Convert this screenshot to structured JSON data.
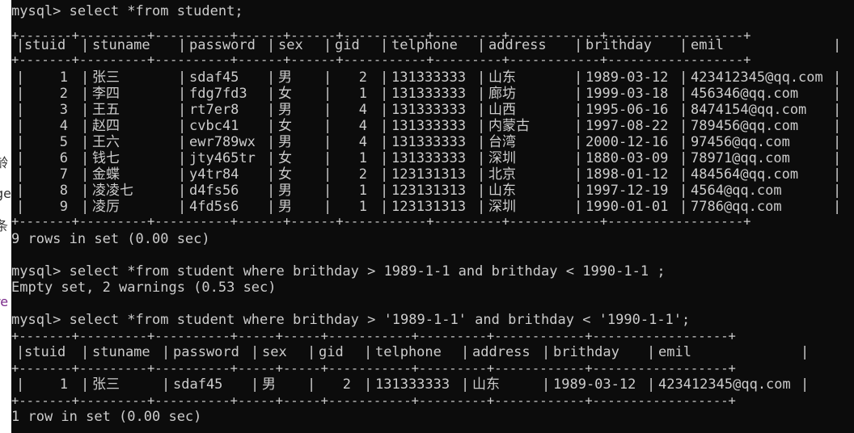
{
  "terminal": {
    "prompt": "mysql>",
    "lines": [
      {
        "kind": "cmd",
        "text": "select *from student;"
      },
      {
        "kind": "border",
        "text": "+-------+---------+----------+------+------+-----------+---------+------------+------------------+"
      },
      {
        "kind": "row",
        "cells": [
          "stuid",
          "stuname",
          "password",
          "sex",
          "gid",
          "telphone",
          "address",
          "brithday",
          "emil"
        ],
        "align": [
          "l",
          "l",
          "l",
          "l",
          "l",
          "l",
          "l",
          "l",
          "l"
        ]
      },
      {
        "kind": "border",
        "text": "+-------+---------+----------+------+------+-----------+---------+------------+------------------+"
      },
      {
        "kind": "row",
        "cells": [
          "1",
          "张三",
          "sdaf45",
          "男",
          "2",
          "131333333",
          "山东",
          "1989-03-12",
          "423412345@qq.com"
        ],
        "align": [
          "r",
          "l",
          "l",
          "l",
          "r",
          "l",
          "l",
          "l",
          "l"
        ]
      },
      {
        "kind": "row",
        "cells": [
          "2",
          "李四",
          "fdg7fd3",
          "女",
          "1",
          "131333333",
          "廊坊",
          "1999-03-18",
          "456346@qq.com"
        ],
        "align": [
          "r",
          "l",
          "l",
          "l",
          "r",
          "l",
          "l",
          "l",
          "l"
        ]
      },
      {
        "kind": "row",
        "cells": [
          "3",
          "王五",
          "rt7er8",
          "男",
          "4",
          "131333333",
          "山西",
          "1995-06-16",
          "8474154@qq.com"
        ],
        "align": [
          "r",
          "l",
          "l",
          "l",
          "r",
          "l",
          "l",
          "l",
          "l"
        ]
      },
      {
        "kind": "row",
        "cells": [
          "4",
          "赵四",
          "cvbc41",
          "女",
          "4",
          "131333333",
          "内蒙古",
          "1997-08-22",
          "789456@qq.com"
        ],
        "align": [
          "r",
          "l",
          "l",
          "l",
          "r",
          "l",
          "l",
          "l",
          "l"
        ]
      },
      {
        "kind": "row",
        "cells": [
          "5",
          "王六",
          "ewr789wx",
          "男",
          "4",
          "131333333",
          "台湾",
          "2000-12-16",
          "97456@qq.com"
        ],
        "align": [
          "r",
          "l",
          "l",
          "l",
          "r",
          "l",
          "l",
          "l",
          "l"
        ]
      },
      {
        "kind": "row",
        "cells": [
          "6",
          "钱七",
          "jty465tr",
          "女",
          "1",
          "131333333",
          "深圳",
          "1880-03-09",
          "78971@qq.com"
        ],
        "align": [
          "r",
          "l",
          "l",
          "l",
          "r",
          "l",
          "l",
          "l",
          "l"
        ]
      },
      {
        "kind": "row",
        "cells": [
          "7",
          "金蝶",
          "y4tr84",
          "女",
          "2",
          "123131313",
          "北京",
          "1898-01-12",
          "484564@qq.com"
        ],
        "align": [
          "r",
          "l",
          "l",
          "l",
          "r",
          "l",
          "l",
          "l",
          "l"
        ]
      },
      {
        "kind": "row",
        "cells": [
          "8",
          "凌凌七",
          "d4fs56",
          "男",
          "1",
          "123131313",
          "山东",
          "1997-12-19",
          "4564@qq.com"
        ],
        "align": [
          "r",
          "l",
          "l",
          "l",
          "r",
          "l",
          "l",
          "l",
          "l"
        ]
      },
      {
        "kind": "row",
        "cells": [
          "9",
          "凌厉",
          "4fd5s6",
          "男",
          "1",
          "123131313",
          "深圳",
          "1990-01-01",
          "7786@qq.com"
        ],
        "align": [
          "r",
          "l",
          "l",
          "l",
          "r",
          "l",
          "l",
          "l",
          "l"
        ]
      },
      {
        "kind": "border",
        "text": "+-------+---------+----------+------+------+-----------+---------+------------+------------------+"
      },
      {
        "kind": "text",
        "text": "9 rows in set (0.00 sec)"
      },
      {
        "kind": "text",
        "text": ""
      },
      {
        "kind": "cmd",
        "text": "select *from student where brithday > 1989-1-1 and brithday < 1990-1-1 ;"
      },
      {
        "kind": "text",
        "text": "Empty set, 2 warnings (0.53 sec)"
      },
      {
        "kind": "text",
        "text": ""
      },
      {
        "kind": "cmd",
        "text": "select *from student where brithday > '1989-1-1' and brithday < '1990-1-1';"
      },
      {
        "kind": "border",
        "text": "+-------+---------+----------+-----+-----+-----------+---------+------------+------------------+"
      },
      {
        "kind": "row",
        "cells": [
          "stuid",
          "stuname",
          "password",
          "sex",
          "gid",
          "telphone",
          "address",
          "brithday",
          "emil"
        ],
        "align": [
          "l",
          "l",
          "l",
          "l",
          "l",
          "l",
          "l",
          "l",
          "l"
        ],
        "set": 2
      },
      {
        "kind": "border",
        "text": "+-------+---------+----------+-----+-----+-----------+---------+------------+------------------+"
      },
      {
        "kind": "row",
        "cells": [
          "1",
          "张三",
          "sdaf45",
          "男",
          "2",
          "131333333",
          "山东",
          "1989-03-12",
          "423412345@qq.com"
        ],
        "align": [
          "r",
          "l",
          "l",
          "l",
          "r",
          "l",
          "l",
          "l",
          "l"
        ],
        "set": 2
      },
      {
        "kind": "border",
        "text": "+-------+---------+----------+-----+-----+-----------+---------+------------+------------------+"
      },
      {
        "kind": "text",
        "text": "1 row in set (0.00 sec)"
      }
    ]
  },
  "left_strip": [
    "龄",
    "ge",
    "条",
    "re"
  ]
}
